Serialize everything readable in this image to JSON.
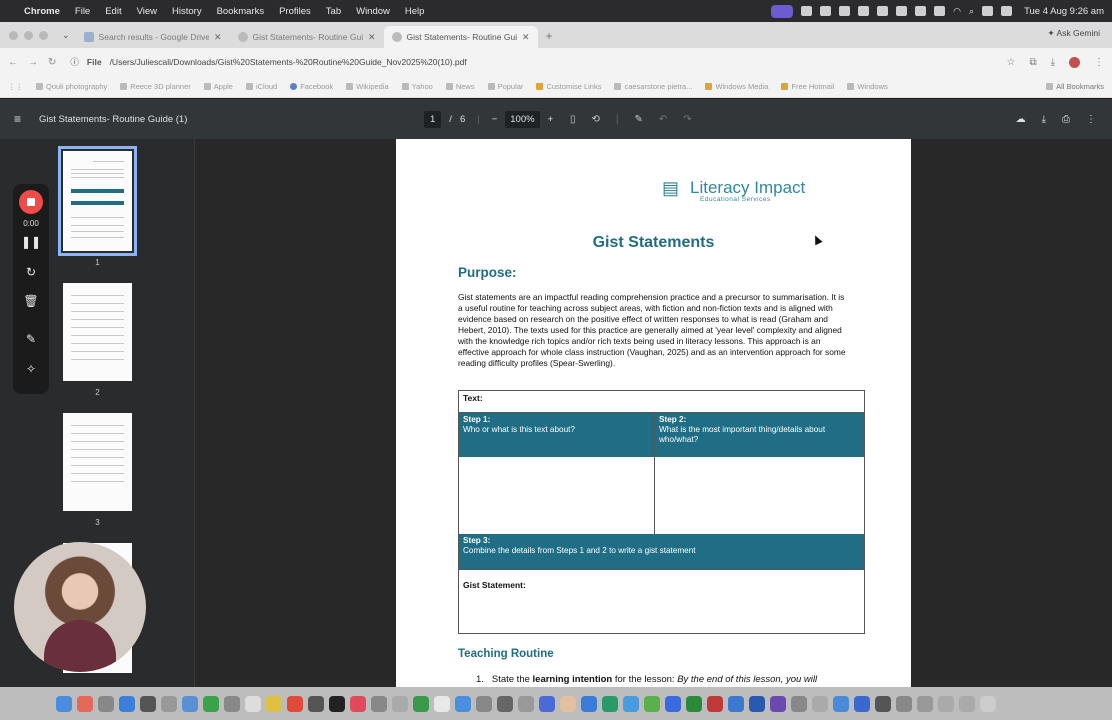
{
  "menubar": {
    "app": "Chrome",
    "items": [
      "File",
      "Edit",
      "View",
      "History",
      "Bookmarks",
      "Profiles",
      "Tab",
      "Window",
      "Help"
    ],
    "clock": "Tue 4 Aug  9:26 am"
  },
  "tabs": [
    {
      "title": "Search results - Google Drive",
      "active": false
    },
    {
      "title": "Gist Statements- Routine Gui...",
      "active": false
    },
    {
      "title": "Gist Statements- Routine Gui...",
      "active": true
    }
  ],
  "ask_gemini": "Ask Gemini",
  "address": {
    "scheme_chip": "File",
    "url": "/Users/Juliescali/Downloads/Gist%20Statements-%20Routine%20Guide_Nov2025%20(10).pdf"
  },
  "bookmarks": {
    "items": [
      "Qouli photography",
      "Reece 3D planner",
      "Apple",
      "iCloud",
      "Facebook",
      "Wikipedia",
      "Yahoo",
      "News",
      "Popular",
      "Customise Links",
      "caesarstone pietra...",
      "Windows Media",
      "Free Hotmail",
      "Windows"
    ],
    "all": "All Bookmarks"
  },
  "pdf_toolbar": {
    "title": "Gist Statements- Routine Guide (1)",
    "page_current": "1",
    "page_sep": "/",
    "page_total": "6",
    "zoom": "100%"
  },
  "thumbnails": [
    {
      "num": "1"
    },
    {
      "num": "2"
    },
    {
      "num": "3"
    }
  ],
  "recorder": {
    "time": "0:00"
  },
  "doc": {
    "logo_text": "Literacy Impact",
    "logo_sub": "Educational Services",
    "title": "Gist Statements",
    "purpose_heading": "Purpose:",
    "purpose_text": "Gist statements are an impactful reading comprehension practice and a precursor to summarisation. It is a useful routine for teaching across subject areas, with fiction and non-fiction texts and is aligned with evidence based on research on the positive effect of written responses to what is read (Graham and Hebert, 2010). The texts used for this practice are generally aimed at 'year level' complexity and aligned with the knowledge rich topics and/or rich texts being used in literacy lessons. This approach is an effective approach for whole class instruction (Vaughan, 2025) and as an intervention approach for some reading difficulty profiles  (Spear-Swerling).",
    "table": {
      "text_label": "Text:",
      "step1_label": "Step 1:",
      "step1_text": "Who or what is this text about?",
      "step2_label": "Step 2:",
      "step2_text": "What is the most important thing/details about who/what?",
      "step3_label": "Step 3:",
      "step3_text": "Combine the details from Steps 1 and 2 to write a gist statement",
      "gist_label": "Gist Statement:"
    },
    "routine_heading": "Teaching Routine",
    "routine_item1_num": "1.",
    "routine_item1_pre": "State the ",
    "routine_item1_bold": "learning intention",
    "routine_item1_mid": " for the lesson: ",
    "routine_item1_italic": "By the end of this lesson, you will"
  },
  "colors": {
    "teal_heading": "#1f6e86",
    "teal_cell": "#1f6e86",
    "record_red": "#ef4b4b",
    "pdf_toolbar": "#323639"
  }
}
